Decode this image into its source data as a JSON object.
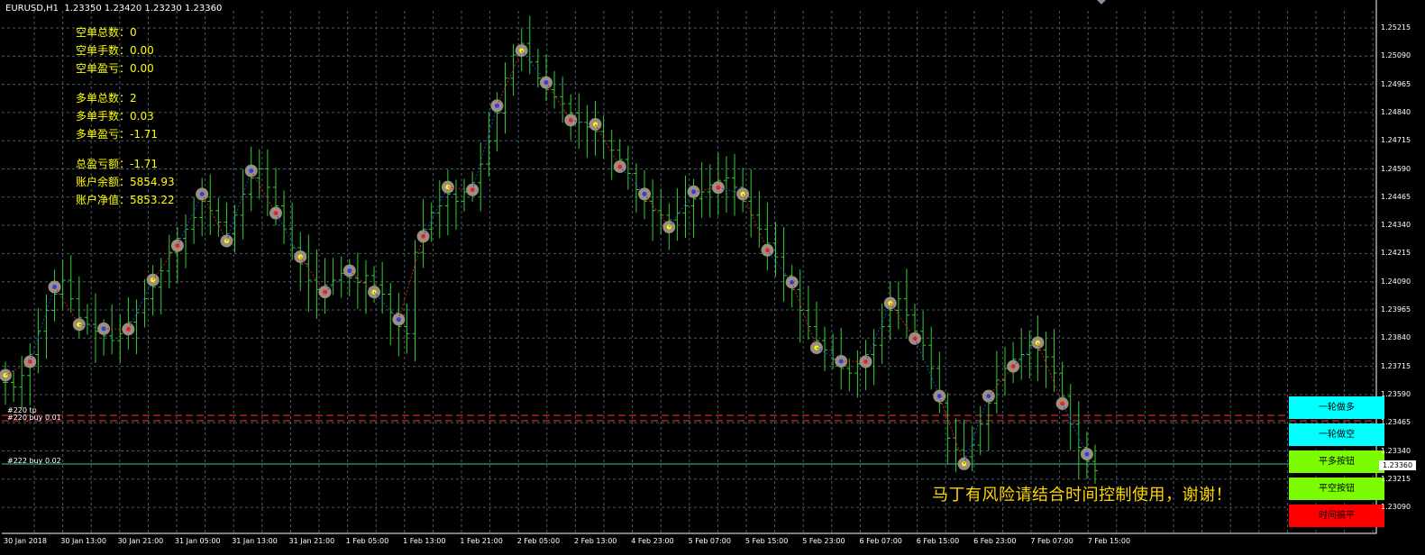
{
  "header": {
    "title": "EURUSD,H1  1.23350 1.23420 1.23230 1.23360"
  },
  "stats": {
    "short_count": "空单总数：0",
    "short_lots": "空单手数：0.00",
    "short_profit": "空单盈亏：0.00",
    "long_count": "多单总数：2",
    "long_lots": "多单手数：0.03",
    "long_profit": "多单盈亏：-1.71",
    "total_profit": "总盈亏额：-1.71",
    "balance": "账户余额：5854.93",
    "equity": "账户净值：5853.22"
  },
  "notice": "马丁有风险请结合时间控制使用，谢谢！",
  "buttons": {
    "round_long": "一轮做多",
    "round_short": "一轮做空",
    "close_long": "平多按钮",
    "close_short": "平空按钮",
    "close_all": "时间搞平"
  },
  "orders": {
    "o1": "#220 tp",
    "o2": "#220 buy 0.01",
    "o3": "#222 buy 0.02"
  },
  "current_price": "1.23360",
  "colors": {
    "background": "#000000",
    "grid": "#4a5a6a",
    "bar": "#32cd32",
    "text_stats": "#ffff00",
    "notice": "#ffd700",
    "btn_cyan": "#00ffff",
    "btn_green": "#7cfc00",
    "btn_red": "#ff0000"
  },
  "price_axis": [
    "1.25215",
    "1.25090",
    "1.24965",
    "1.24840",
    "1.24715",
    "1.24590",
    "1.24465",
    "1.24340",
    "1.24215",
    "1.24090",
    "1.23965",
    "1.23840",
    "1.23715",
    "1.23590",
    "1.23465",
    "1.23340",
    "1.23215",
    "1.23090"
  ],
  "time_axis": [
    "30 Jan 2018",
    "30 Jan 13:00",
    "30 Jan 21:00",
    "31 Jan 05:00",
    "31 Jan 13:00",
    "31 Jan 21:00",
    "1 Feb 05:00",
    "1 Feb 13:00",
    "1 Feb 21:00",
    "2 Feb 05:00",
    "2 Feb 13:00",
    "4 Feb 23:00",
    "5 Feb 07:00",
    "5 Feb 15:00",
    "5 Feb 23:00",
    "6 Feb 07:00",
    "6 Feb 15:00",
    "6 Feb 23:00",
    "7 Feb 07:00",
    "7 Feb 15:00"
  ],
  "chart_data": {
    "type": "ohlc",
    "symbol": "EURUSD",
    "timeframe": "H1",
    "ylim": [
      1.2309,
      1.2534
    ],
    "close_series": [
      1.2374,
      1.2372,
      1.2377,
      1.2386,
      1.2396,
      1.2405,
      1.2412,
      1.2418,
      1.241,
      1.2402,
      1.2399,
      1.2396,
      1.2394,
      1.2392,
      1.2395,
      1.24,
      1.2404,
      1.241,
      1.2415,
      1.2422,
      1.243,
      1.2436,
      1.244,
      1.2445,
      1.2452,
      1.2448,
      1.2443,
      1.2438,
      1.2446,
      1.2455,
      1.2462,
      1.2466,
      1.2458,
      1.245,
      1.244,
      1.2432,
      1.2425,
      1.2418,
      1.2414,
      1.2416,
      1.2418,
      1.2421,
      1.2419,
      1.2417,
      1.242,
      1.2416,
      1.2412,
      1.2404,
      1.2398,
      1.2395,
      1.243,
      1.244,
      1.2447,
      1.245,
      1.2455,
      1.2452,
      1.2456,
      1.246,
      1.2468,
      1.2478,
      1.249,
      1.2505,
      1.2515,
      1.252,
      1.2512,
      1.2505,
      1.25,
      1.2497,
      1.2494,
      1.249,
      1.2486,
      1.2484,
      1.2482,
      1.2478,
      1.2474,
      1.247,
      1.2464,
      1.2457,
      1.2452,
      1.2448,
      1.2446,
      1.2444,
      1.2447,
      1.245,
      1.2453,
      1.2456,
      1.2459,
      1.2461,
      1.2462,
      1.2458,
      1.2452,
      1.2446,
      1.244,
      1.2434,
      1.2428,
      1.242,
      1.2414,
      1.2405,
      1.2398,
      1.2392,
      1.2388,
      1.2384,
      1.238,
      1.2378,
      1.2382,
      1.2386,
      1.239,
      1.2398,
      1.2405,
      1.241,
      1.2403,
      1.2396,
      1.239,
      1.238,
      1.2365,
      1.235,
      1.2345,
      1.2342,
      1.2347,
      1.2356,
      1.2365,
      1.2375,
      1.238,
      1.2384,
      1.2386,
      1.239,
      1.2388,
      1.2385,
      1.2378,
      1.2368,
      1.2356,
      1.2346,
      1.234,
      1.2336
    ]
  }
}
